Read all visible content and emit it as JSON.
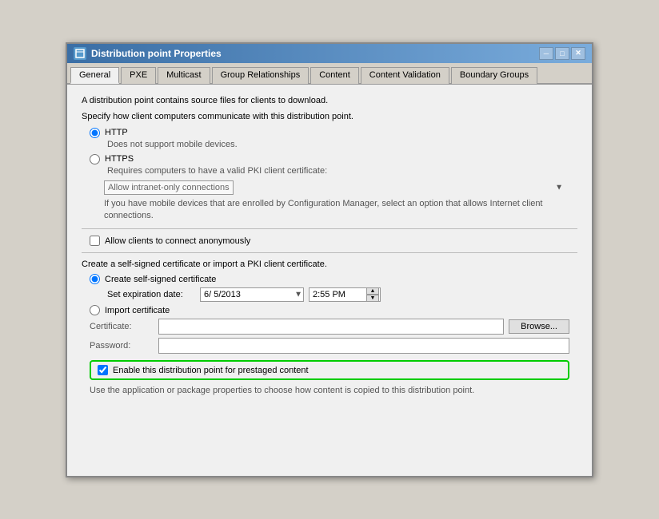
{
  "window": {
    "title": "Distribution point Properties"
  },
  "tabs": [
    {
      "id": "general",
      "label": "General",
      "active": true
    },
    {
      "id": "pxe",
      "label": "PXE",
      "active": false
    },
    {
      "id": "multicast",
      "label": "Multicast",
      "active": false
    },
    {
      "id": "group-relationships",
      "label": "Group Relationships",
      "active": false
    },
    {
      "id": "content",
      "label": "Content",
      "active": false
    },
    {
      "id": "content-validation",
      "label": "Content Validation",
      "active": false
    },
    {
      "id": "boundary-groups",
      "label": "Boundary Groups",
      "active": false
    }
  ],
  "content": {
    "description1": "A distribution point contains source files for clients to download.",
    "description2": "Specify how client computers communicate with this distribution point.",
    "http_label": "HTTP",
    "http_note": "Does not support mobile devices.",
    "https_label": "HTTPS",
    "https_note": "Requires computers to have a valid PKI client certificate:",
    "dropdown_value": "Allow intranet-only connections",
    "mobile_note": "If you have mobile devices that are enrolled by Configuration Manager, select an option that allows Internet client connections.",
    "anonymous_label": "Allow clients to connect anonymously",
    "cert_description": "Create a self-signed certificate or import a PKI client certificate.",
    "create_cert_label": "Create self-signed certificate",
    "expiry_label": "Set expiration date:",
    "date_value": "6/ 5/2013",
    "time_value": "2:55 PM",
    "import_cert_label": "Import certificate",
    "cert_field_label": "Certificate:",
    "password_field_label": "Password:",
    "browse_label": "Browse...",
    "prestaged_label": "Enable this distribution point for prestaged content",
    "prestaged_note": "Use the application or package properties to choose how content is copied to this distribution point."
  }
}
